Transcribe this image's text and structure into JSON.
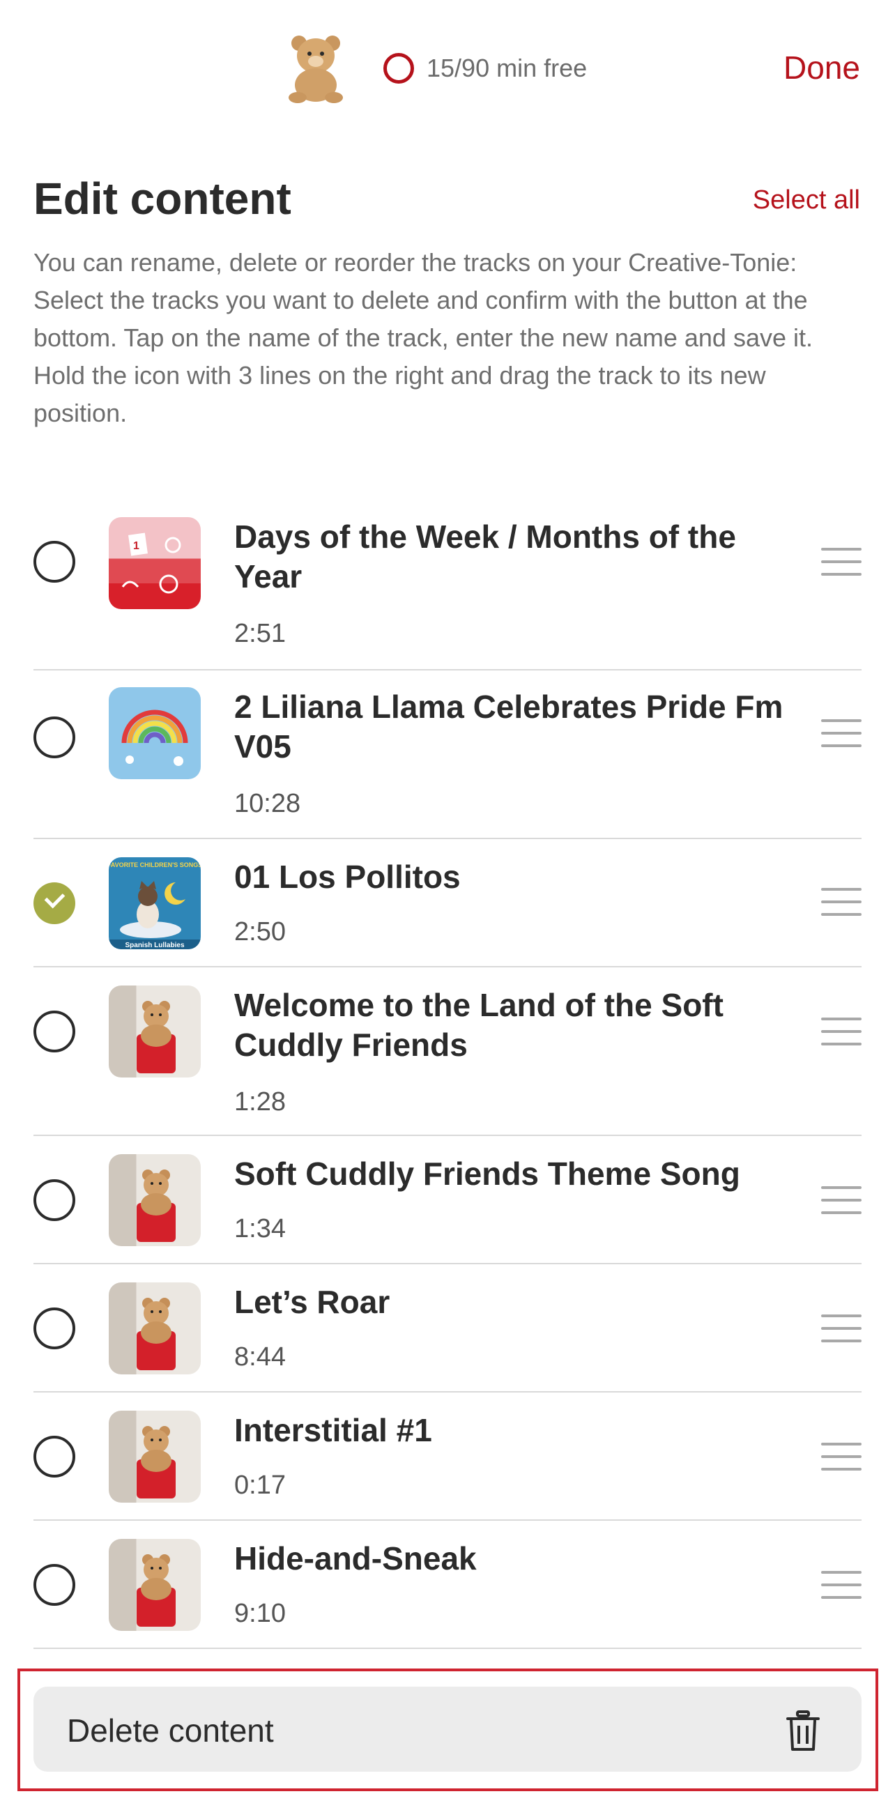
{
  "header": {
    "minutes_free": "15/90 min free",
    "done_label": "Done"
  },
  "page": {
    "title": "Edit content",
    "select_all_label": "Select all",
    "description": "You can rename, delete or reorder the tracks on your Creative-Tonie: Select the tracks you want to delete and confirm with the button at the bottom. Tap on the name of the track, enter the new name and save it. Hold the icon with 3 lines on the right and drag the track to its new position."
  },
  "tracks": [
    {
      "name": "Days of the Week / Months of the Year",
      "duration": "2:51",
      "selected": false,
      "thumb": "calendar-thumbnail"
    },
    {
      "name": "2 Liliana Llama Celebrates Pride Fm V05",
      "duration": "10:28",
      "selected": false,
      "thumb": "rainbow-thumbnail"
    },
    {
      "name": "01 Los Pollitos",
      "duration": "2:50",
      "selected": true,
      "thumb": "spanish-lullabies-thumbnail"
    },
    {
      "name": "Welcome to the Land of the Soft Cuddly Friends",
      "duration": "1:28",
      "selected": false,
      "thumb": "teddy-bear-thumbnail"
    },
    {
      "name": "Soft Cuddly Friends Theme Song",
      "duration": "1:34",
      "selected": false,
      "thumb": "teddy-bear-thumbnail"
    },
    {
      "name": "Let’s Roar",
      "duration": "8:44",
      "selected": false,
      "thumb": "teddy-bear-thumbnail"
    },
    {
      "name": "Interstitial #1",
      "duration": "0:17",
      "selected": false,
      "thumb": "teddy-bear-thumbnail"
    },
    {
      "name": "Hide-and-Sneak",
      "duration": "9:10",
      "selected": false,
      "thumb": "teddy-bear-thumbnail"
    }
  ],
  "thumbnail_text": {
    "spanish_top": "FAVORITE CHILDREN'S SONGS",
    "spanish_bottom": "Spanish Lullabies"
  },
  "footer": {
    "delete_label": "Delete content"
  },
  "colors": {
    "accent": "#b5121b",
    "selected_check": "#a5ab45",
    "highlight_frame": "#cf2430"
  }
}
